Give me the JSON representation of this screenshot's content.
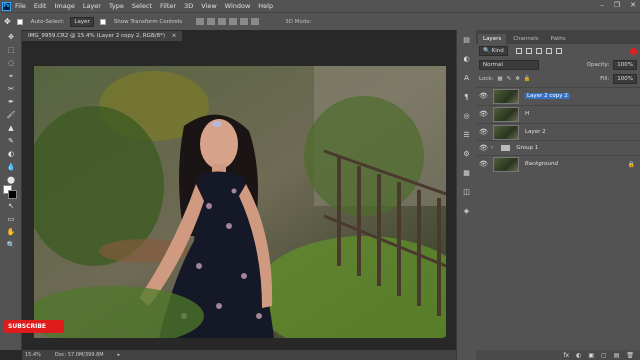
{
  "menubar": {
    "logo": "Ps",
    "items": [
      "File",
      "Edit",
      "Image",
      "Layer",
      "Type",
      "Select",
      "Filter",
      "3D",
      "View",
      "Window",
      "Help"
    ],
    "window_controls": [
      "–",
      "❐",
      "✕"
    ]
  },
  "options": {
    "auto_select_label": "Auto-Select:",
    "auto_select_value": "Layer",
    "transform_label": "Show Transform Controls",
    "mode_3d": "3D Mode:"
  },
  "document": {
    "tab_title": "IMG_9959.CR2 @ 15.4% (Layer 2 copy 2, RGB/8*)",
    "zoom": "15.4%",
    "doc_info": "Doc: 57.0M/399.8M"
  },
  "overlay": {
    "subscribe": "SUBSCRIBE"
  },
  "tools": [
    "✥",
    "⬚",
    "◌",
    "⌖",
    "✂",
    "✒",
    "🖌",
    "▲",
    "✎",
    "◐",
    "💧",
    "⬤",
    "T",
    "↖",
    "▭",
    "✋",
    "🔍"
  ],
  "strip_icons": [
    "▤",
    "◐",
    "A",
    "¶",
    "◎",
    "☰",
    "⚙",
    "▦",
    "◫",
    "◈"
  ],
  "layers_panel": {
    "tabs": [
      "Layers",
      "Channels",
      "Paths"
    ],
    "active_tab": "Layers",
    "kind": "Kind",
    "blend_mode": "Normal",
    "opacity_label": "Opacity:",
    "opacity_value": "100%",
    "lock_label": "Lock:",
    "fill_label": "Fill:",
    "fill_value": "100%",
    "layers": [
      {
        "name": "Layer 2 copy 2",
        "selected": true
      },
      {
        "name": "H",
        "selected": false
      },
      {
        "name": "Layer 2",
        "selected": false
      },
      {
        "name": "Group 1",
        "group": true
      },
      {
        "name": "Background",
        "locked": true
      }
    ],
    "bottom_icons": [
      "fx",
      "◐",
      "▣",
      "▢",
      "▤",
      "🗑"
    ]
  },
  "colors": {
    "selected_layer": "#3672c4",
    "subscribe_bg": "#e01b1b"
  }
}
